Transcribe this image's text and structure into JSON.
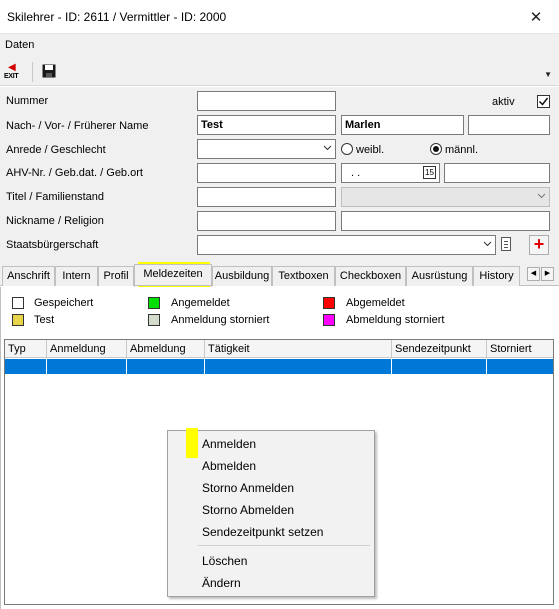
{
  "window": {
    "title": "Skilehrer - ID: 2611 / Vermittler - ID: 2000"
  },
  "menubar": {
    "items": [
      "Daten"
    ]
  },
  "toolbar": {
    "exit_label": "EXIT"
  },
  "form": {
    "labels": {
      "nummer": "Nummer",
      "name": "Nach- / Vor- / Früherer Name",
      "anrede": "Anrede / Geschlecht",
      "ahv": "AHV-Nr. / Geb.dat. / Geb.ort",
      "titel": "Titel / Familienstand",
      "nickname": "Nickname  / Religion",
      "staat": "Staatsbürgerschaft",
      "aktiv": "aktiv"
    },
    "values": {
      "nummer": "",
      "nachname": "Test",
      "vorname": "Marlen",
      "frueherer_name": "",
      "anrede": "",
      "ahv_nr": "",
      "geb_dat": " .  .",
      "geb_ort": "",
      "titel": "",
      "familienstand": "",
      "nickname": "",
      "religion": "",
      "staatsbuergerschaft": ""
    },
    "gender": {
      "female": "weibl.",
      "male": "männl.",
      "selected": "männl."
    },
    "aktiv_checked": true,
    "date_icon_label": "15"
  },
  "tabs": {
    "items": [
      "Anschrift",
      "Intern",
      "Profil",
      "Meldezeiten",
      "Ausbildung",
      "Textboxen",
      "Checkboxen",
      "Ausrüstung",
      "History"
    ],
    "active": "Meldezeiten"
  },
  "legend": [
    {
      "label": "Gespeichert",
      "color": "#ffffff"
    },
    {
      "label": "Angemeldet",
      "color": "#00e000"
    },
    {
      "label": "Abgemeldet",
      "color": "#ff0000"
    },
    {
      "label": "Test",
      "color": "#e6d44a"
    },
    {
      "label": "Anmeldung storniert",
      "color": "#d4dccc"
    },
    {
      "label": "Abmeldung storniert",
      "color": "#ff00ff"
    }
  ],
  "grid": {
    "columns": [
      "Typ",
      "Anmeldung",
      "Abmeldung",
      "Tätigkeit",
      "Sendezeitpunkt",
      "Storniert"
    ],
    "selection_color": "#0078d7"
  },
  "context_menu": {
    "items": [
      "Anmelden",
      "Abmelden",
      "Storno Anmelden",
      "Storno Abmelden",
      "Sendezeitpunkt setzen",
      "Löschen",
      "Ändern"
    ]
  },
  "colors": {
    "highlight": "#ffff00",
    "add_button": "#e00000"
  }
}
